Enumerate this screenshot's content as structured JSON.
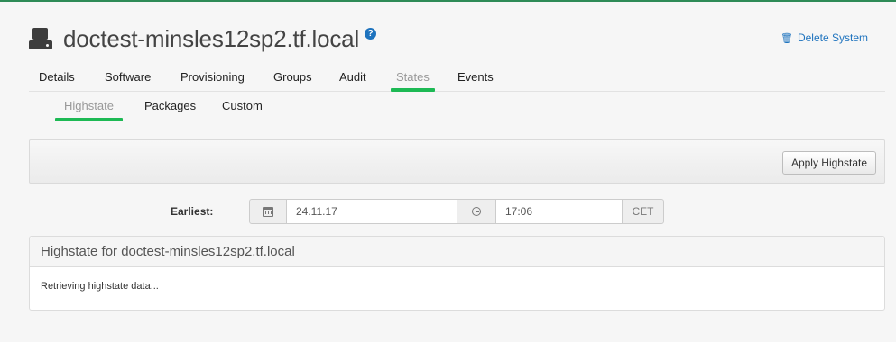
{
  "header": {
    "system_icon": "system-icon",
    "title": "doctest-minsles12sp2.tf.local",
    "help_glyph": "?",
    "delete_label": "Delete System",
    "delete_icon": "trash-icon"
  },
  "tabs": [
    {
      "label": "Details",
      "active": false
    },
    {
      "label": "Software",
      "active": false
    },
    {
      "label": "Provisioning",
      "active": false
    },
    {
      "label": "Groups",
      "active": false
    },
    {
      "label": "Audit",
      "active": false
    },
    {
      "label": "States",
      "active": true
    },
    {
      "label": "Events",
      "active": false
    }
  ],
  "subtabs": [
    {
      "label": "Highstate",
      "active": true
    },
    {
      "label": "Packages",
      "active": false
    },
    {
      "label": "Custom",
      "active": false
    }
  ],
  "actions": {
    "apply_label": "Apply Highstate"
  },
  "schedule": {
    "earliest_label": "Earliest:",
    "calendar_icon": "calendar-icon",
    "date_value": "24.11.17",
    "clock_icon": "clock-icon",
    "time_value": "17:06",
    "timezone": "CET"
  },
  "panel": {
    "heading": "Highstate for doctest-minsles12sp2.tf.local",
    "body": "Retrieving highstate data..."
  },
  "colors": {
    "accent_green": "#1db954",
    "link_blue": "#1e73be",
    "top_border": "#2e8b57"
  }
}
